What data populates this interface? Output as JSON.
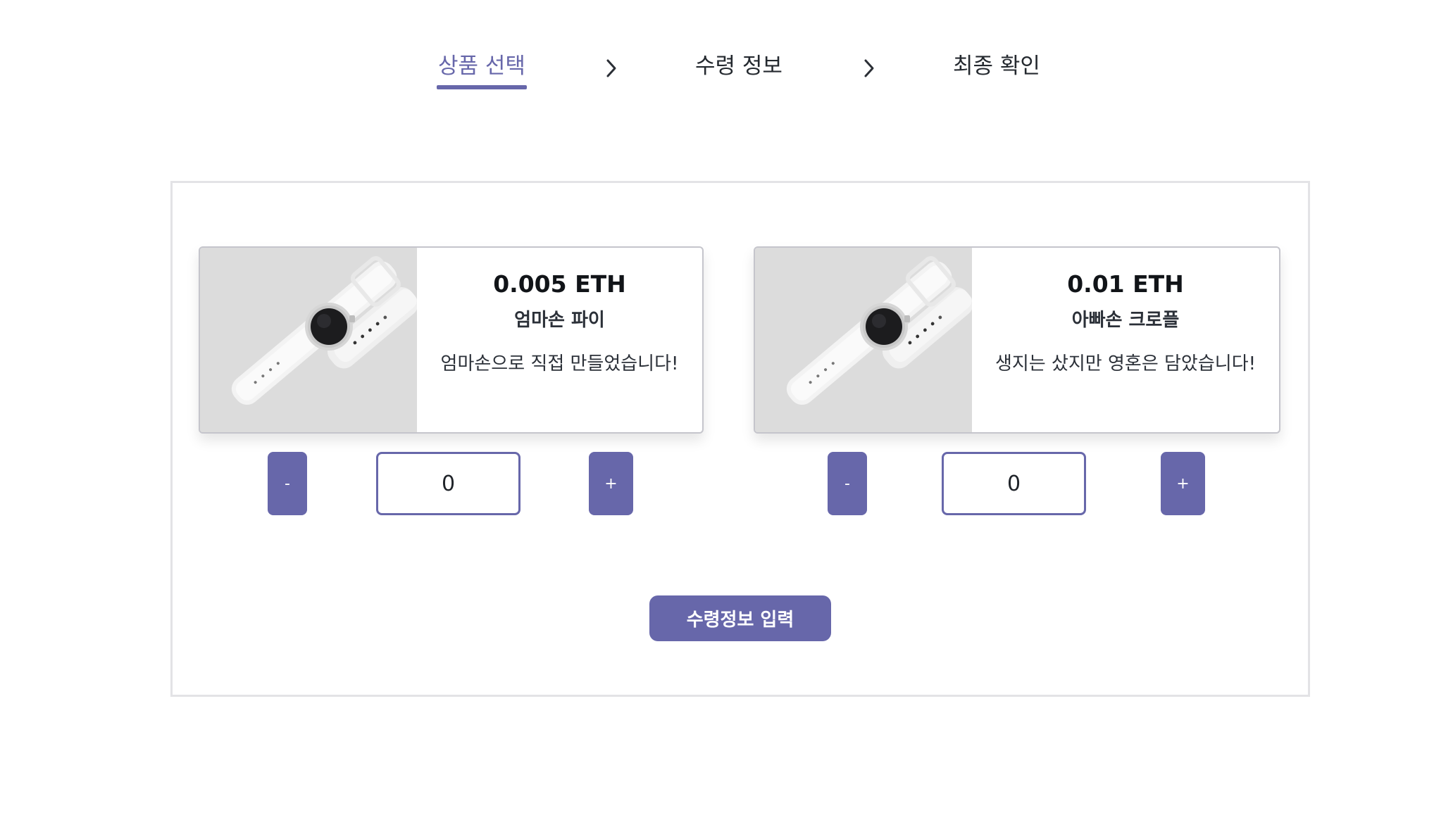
{
  "steps": [
    {
      "label": "상품 선택",
      "active": true
    },
    {
      "label": "수령 정보",
      "active": false
    },
    {
      "label": "최종 확인",
      "active": false
    }
  ],
  "products": [
    {
      "price": "0.005 ETH",
      "name": "엄마손 파이",
      "description": "엄마손으로 직접 만들었습니다!",
      "quantity": "0",
      "minus_label": "-",
      "plus_label": "+"
    },
    {
      "price": "0.01 ETH",
      "name": "아빠손 크로플",
      "description": "생지는 샀지만 영혼은 담았습니다!",
      "quantity": "0",
      "minus_label": "-",
      "plus_label": "+"
    }
  ],
  "submit_label": "수령정보 입력",
  "colors": {
    "accent": "#6767aa",
    "panel_border": "#e3e3e6",
    "card_border": "#c5c5cc"
  },
  "icons": {
    "step_separator": "chevron-right-icon",
    "product_image": "watch-image"
  }
}
